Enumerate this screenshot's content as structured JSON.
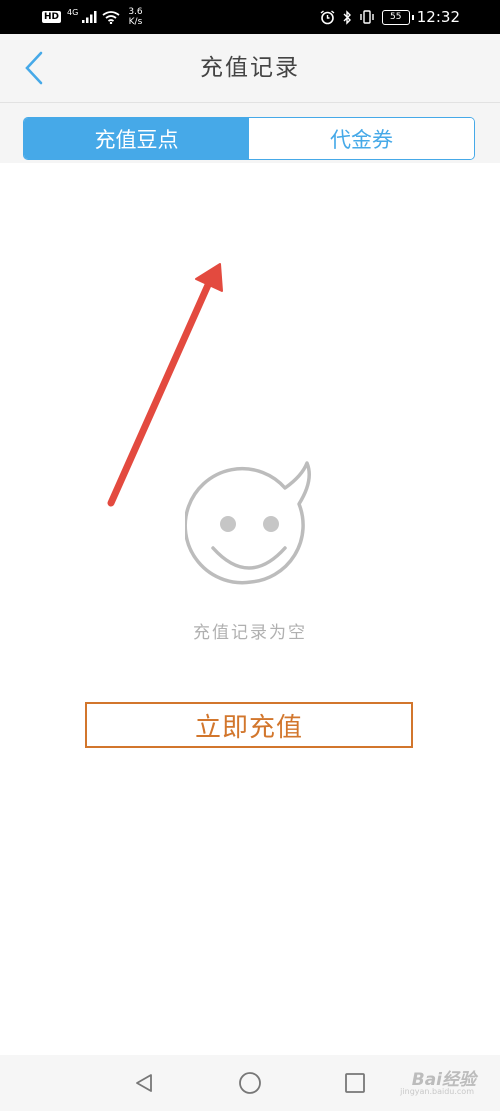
{
  "status_bar": {
    "hd": "HD",
    "network": "4G",
    "speed_value": "3.6",
    "speed_unit": "K/s",
    "battery": "55",
    "time": "12:32"
  },
  "header": {
    "title": "充值记录"
  },
  "tabs": [
    {
      "label": "充值豆点",
      "active": true
    },
    {
      "label": "代金券",
      "active": false
    }
  ],
  "empty_state": {
    "message": "充值记录为空"
  },
  "recharge_button": {
    "label": "立即充值"
  },
  "watermark": {
    "text": "Bai经验",
    "sub": "jingyan.baidu.com"
  },
  "colors": {
    "accent": "#46a9e8",
    "button": "#d2762c",
    "annotation_arrow": "#e34a3f"
  }
}
